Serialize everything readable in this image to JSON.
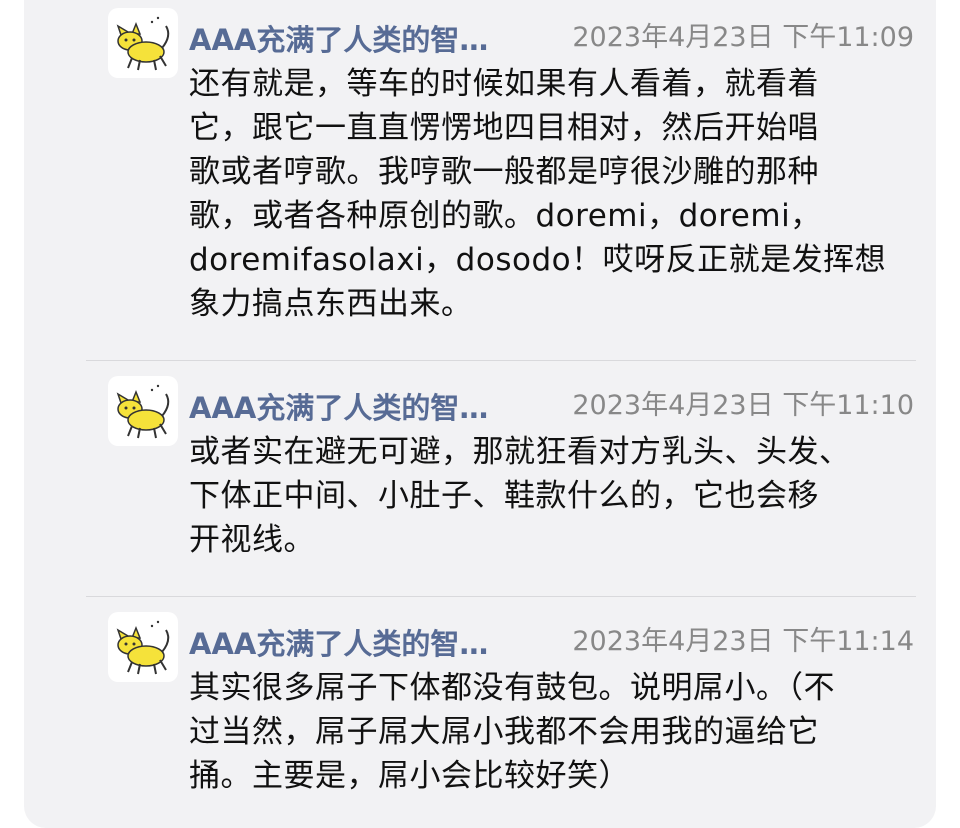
{
  "messages": [
    {
      "sender": "AAA充满了人类的智…",
      "time": "2023年4月23日 下午11:09",
      "avatar_icon": "yellow-cat-icon",
      "lines": [
        "还有就是，等车的时候如果有人看着，就看着",
        "它，跟它一直直愣愣地四目相对，然后开始唱",
        "歌或者哼歌。我哼歌一般都是哼很沙雕的那种",
        "歌，或者各种原创的歌。doremi，doremi，",
        "doremifasolaxi，dosodo！哎呀反正就是发挥想",
        "象力搞点东西出来。"
      ]
    },
    {
      "sender": "AAA充满了人类的智…",
      "time": "2023年4月23日 下午11:10",
      "avatar_icon": "yellow-cat-icon",
      "lines": [
        "或者实在避无可避，那就狂看对方乳头、头发、",
        "下体正中间、小肚子、鞋款什么的，它也会移",
        "开视线。"
      ]
    },
    {
      "sender": "AAA充满了人类的智…",
      "time": "2023年4月23日 下午11:14",
      "avatar_icon": "yellow-cat-icon",
      "lines": [
        "其实很多屌子下体都没有鼓包。说明屌小。（不",
        "过当然，屌子屌大屌小我都不会用我的逼给它",
        "捅。主要是，屌小会比较好笑）"
      ]
    }
  ],
  "colors": {
    "name": "#576b95",
    "time": "#888888",
    "text": "#111111",
    "card_bg": "#f2f2f4",
    "avatar_cat": "#f5e23a"
  }
}
